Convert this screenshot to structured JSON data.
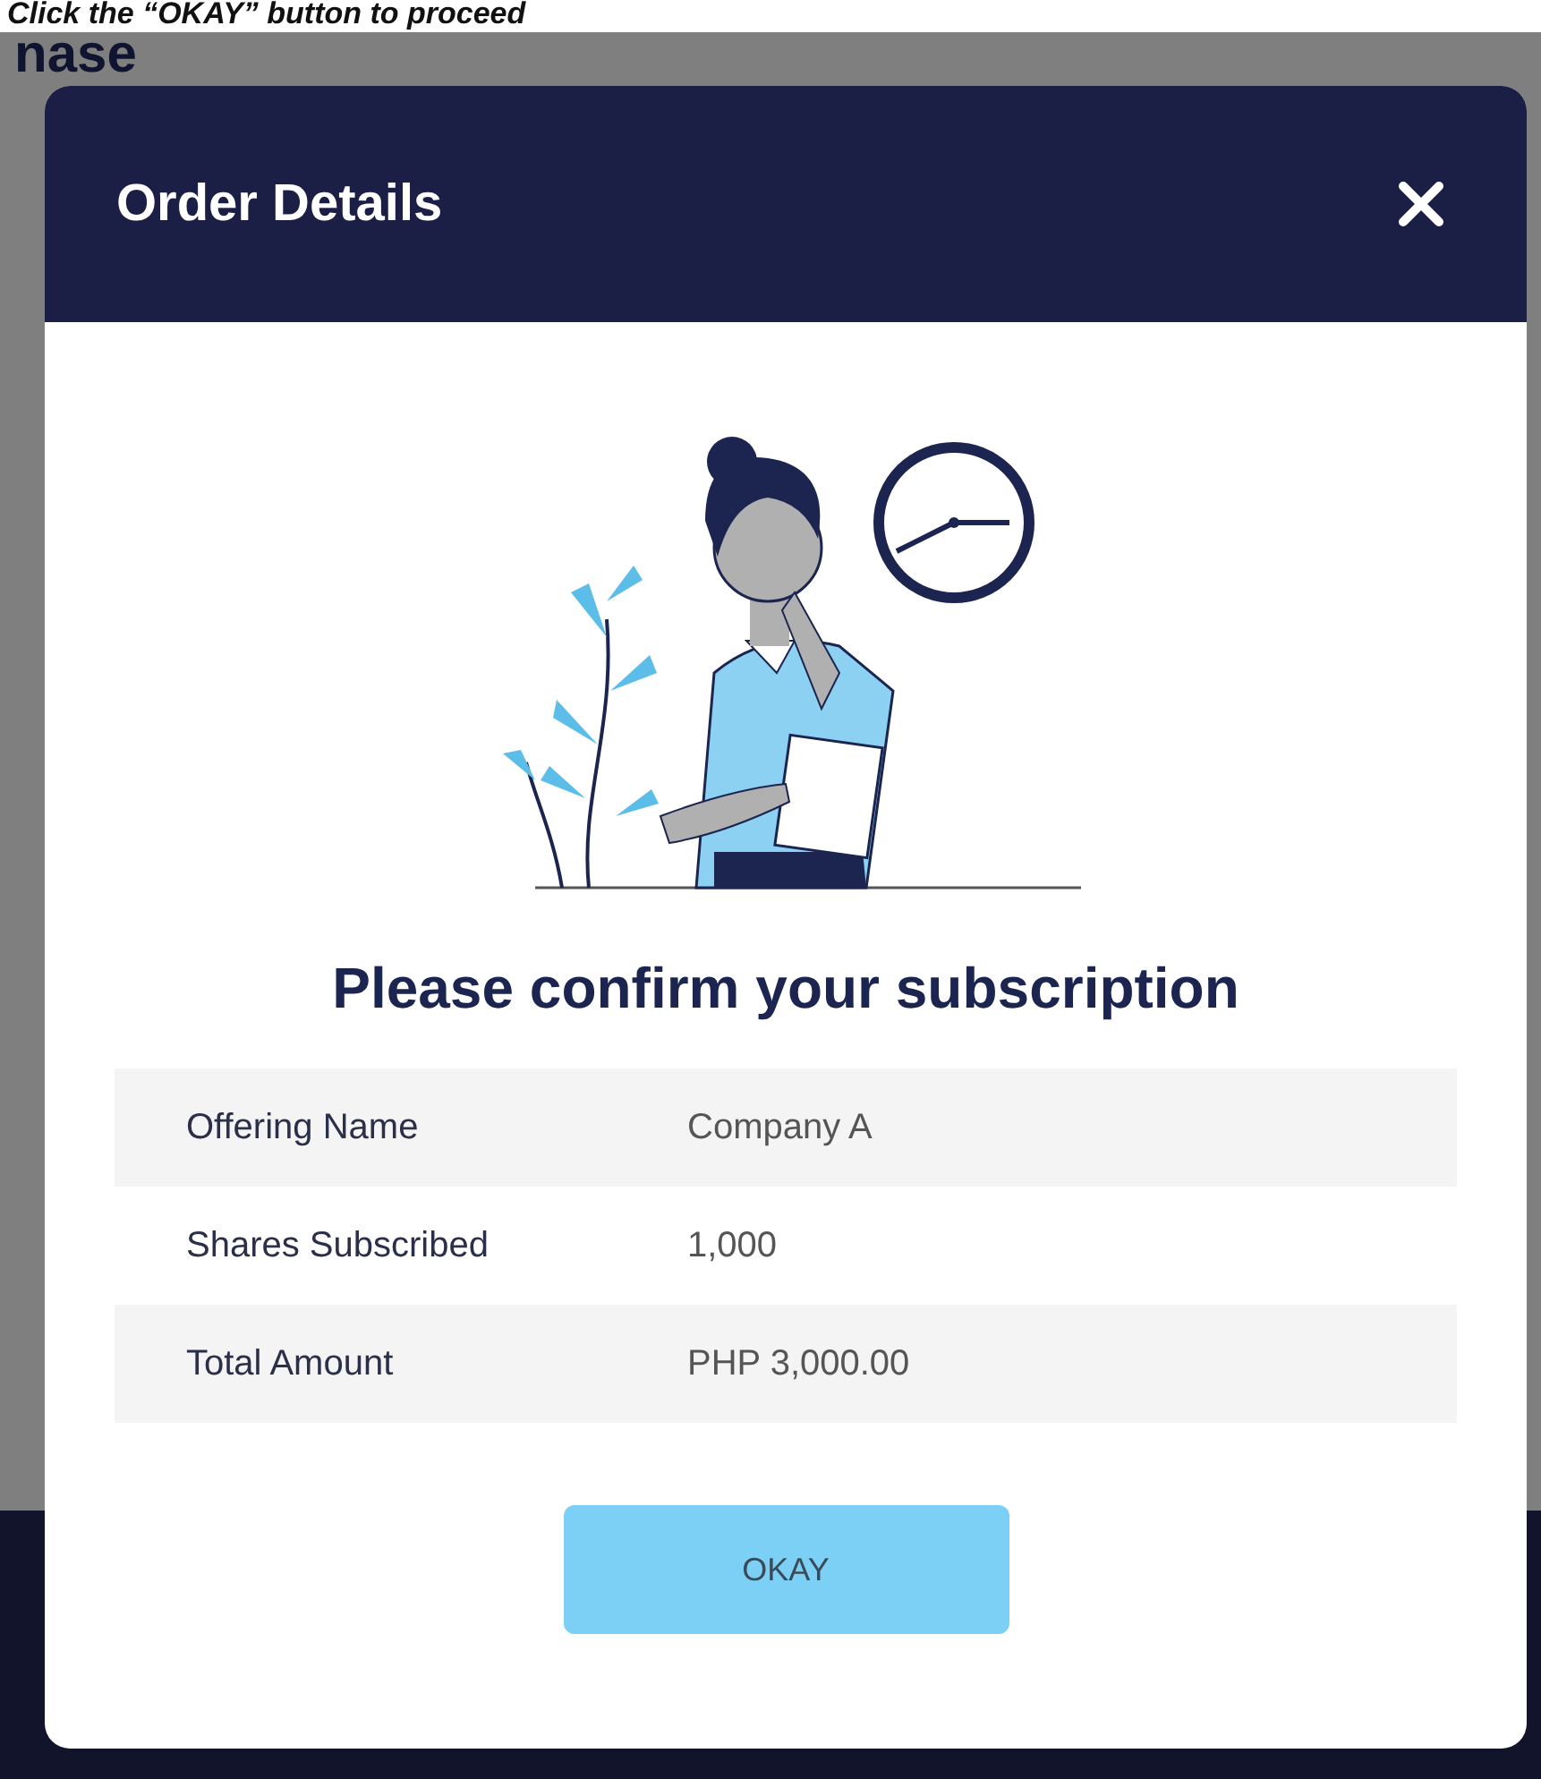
{
  "instruction": "Click the “OKAY” button to proceed",
  "background": {
    "heading": "nase"
  },
  "dialog": {
    "title": "Order Details",
    "prompt": "Please confirm your subscription",
    "details": [
      {
        "label": "Offering Name",
        "value": "Company A"
      },
      {
        "label": "Shares Subscribed",
        "value": "1,000"
      },
      {
        "label": "Total Amount",
        "value": "PHP 3,000.00"
      }
    ],
    "buttons": [
      {
        "label": "OKAY"
      }
    ]
  }
}
